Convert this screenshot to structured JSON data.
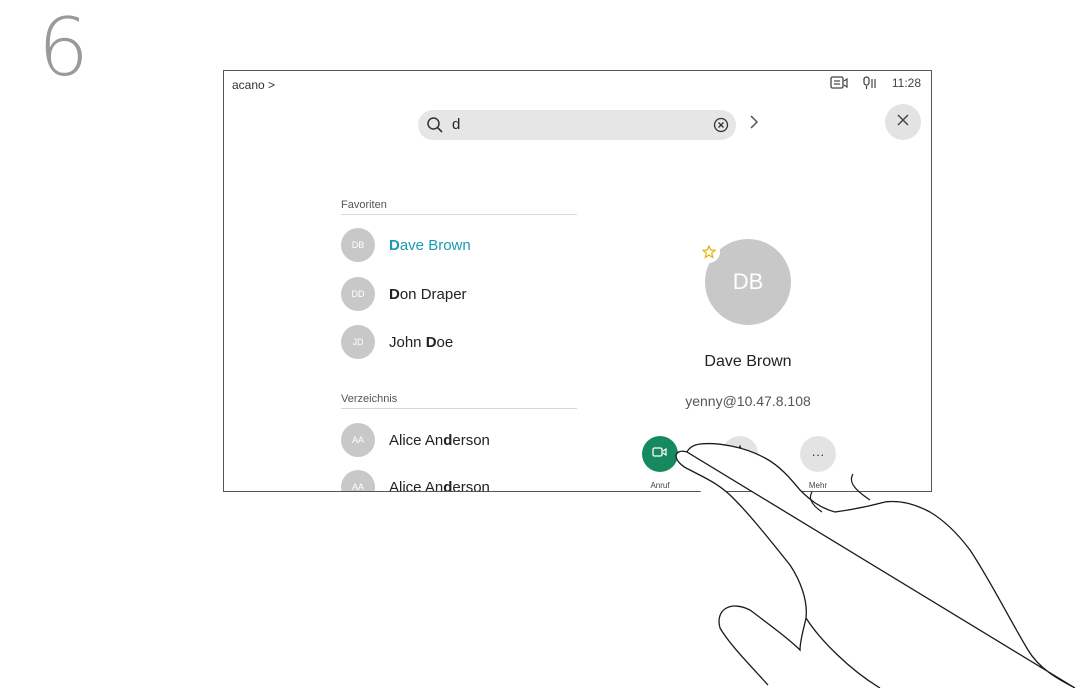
{
  "step_number": "6",
  "topbar": {
    "breadcrumb": "acano >",
    "time": "11:28",
    "icons": [
      "screen-share-icon",
      "microphone-icon"
    ]
  },
  "search": {
    "query": "d",
    "icons": [
      "search-icon",
      "clear-icon"
    ]
  },
  "favorites": {
    "label": "Favoriten",
    "items": [
      {
        "initials": "DB",
        "prefix": "",
        "match": "D",
        "rest": "ave Brown",
        "active": true
      },
      {
        "initials": "DD",
        "prefix": "",
        "match": "D",
        "rest": "on Draper",
        "active": false
      },
      {
        "initials": "JD",
        "prefix": "John ",
        "match": "D",
        "rest": "oe",
        "active": false
      }
    ]
  },
  "directory": {
    "label": "Verzeichnis",
    "items": [
      {
        "initials": "AA",
        "prefix": "Alice An",
        "match": "d",
        "rest": "erson"
      },
      {
        "initials": "AA",
        "prefix": "Alice An",
        "match": "d",
        "rest": "erson"
      }
    ]
  },
  "detail": {
    "initials": "DB",
    "name": "Dave Brown",
    "address": "yenny@10.47.8.108",
    "actions": {
      "call_label": "Anruf",
      "more_label": "Mehr",
      "more_symbol": "···"
    }
  },
  "colors": {
    "accent": "#1b9ab0",
    "call_green": "#168a5e",
    "favorite_star": "#e8b100"
  }
}
